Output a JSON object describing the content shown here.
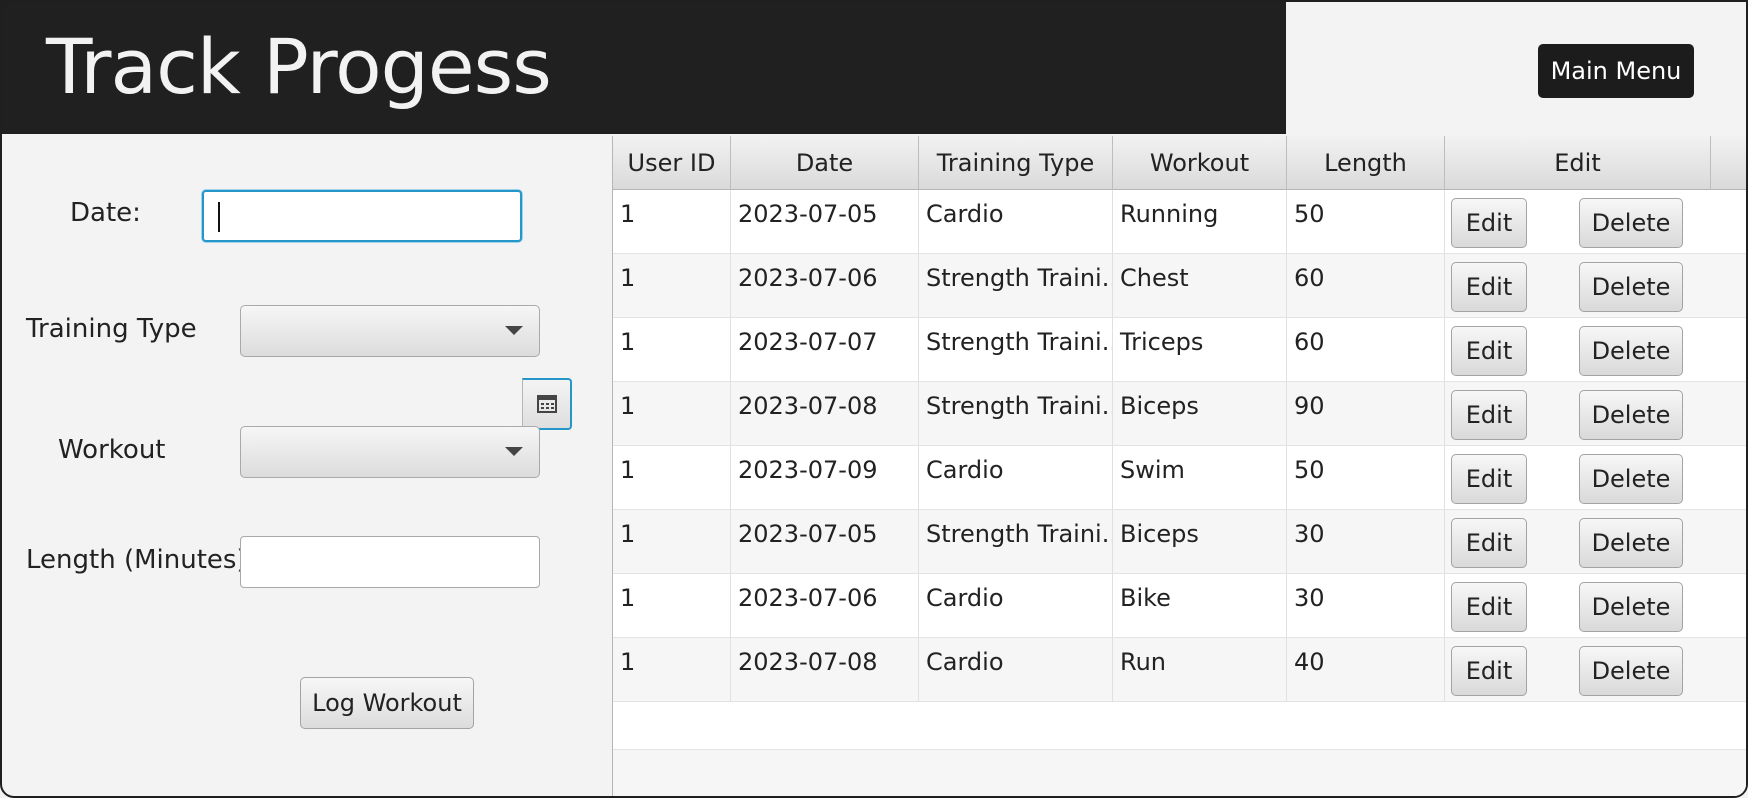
{
  "header": {
    "title": "Track Progess",
    "main_menu_label": "Main Menu"
  },
  "form": {
    "date_label": "Date:",
    "date_value": "",
    "date_picker_icon": "calendar-icon",
    "training_type_label": "Training Type",
    "training_type_value": "",
    "workout_label": "Workout",
    "workout_value": "",
    "length_label": "Length (Minutes)",
    "length_value": "",
    "log_button_label": "Log Workout"
  },
  "table": {
    "columns": [
      "User ID",
      "Date",
      "Training Type",
      "Workout",
      "Length",
      "Edit"
    ],
    "edit_label": "Edit",
    "delete_label": "Delete",
    "rows": [
      [
        "1",
        "2023-07-05",
        "Cardio",
        "Running",
        "50"
      ],
      [
        "1",
        "2023-07-06",
        "Strength Traini...",
        "Chest",
        "60"
      ],
      [
        "1",
        "2023-07-07",
        "Strength Traini...",
        "Triceps",
        "60"
      ],
      [
        "1",
        "2023-07-08",
        "Strength Traini...",
        "Biceps",
        "90"
      ],
      [
        "1",
        "2023-07-09",
        "Cardio",
        "Swim",
        "50"
      ],
      [
        "1",
        "2023-07-05",
        "Strength Traini...",
        "Biceps",
        "30"
      ],
      [
        "1",
        "2023-07-06",
        "Cardio",
        "Bike",
        "30"
      ],
      [
        "1",
        "2023-07-08",
        "Cardio",
        "Run",
        "40"
      ]
    ]
  },
  "colors": {
    "header_bg": "#202020",
    "focus_border": "#2496c8",
    "panel_bg": "#f3f3f3"
  }
}
